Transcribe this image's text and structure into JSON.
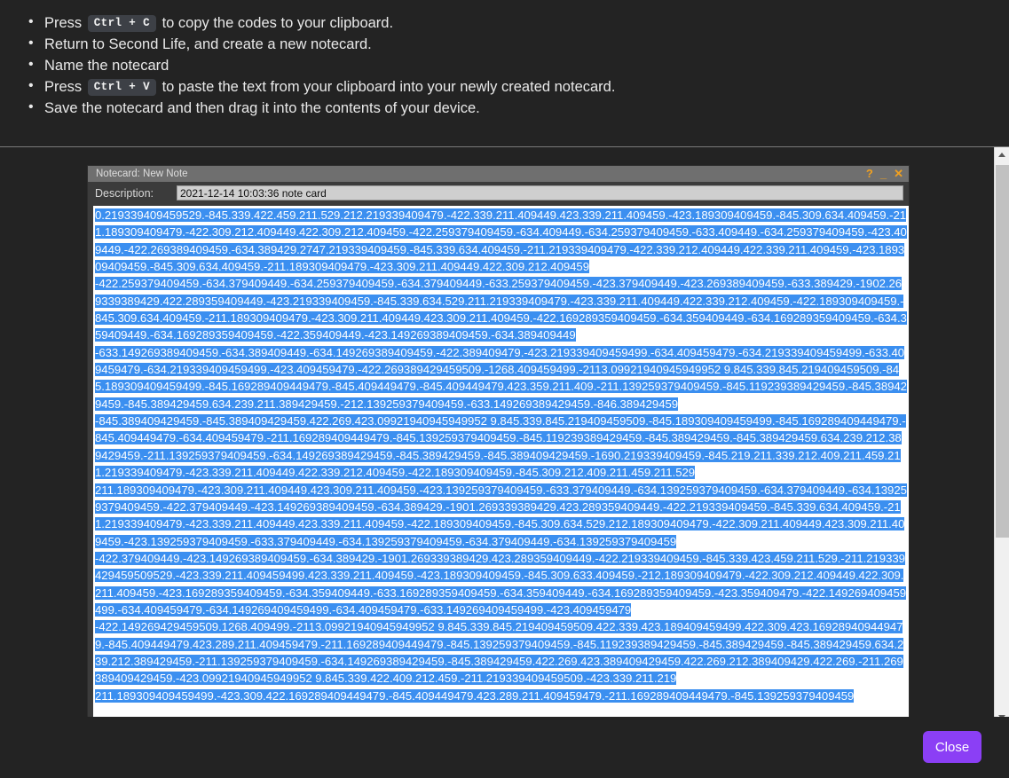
{
  "instructions": {
    "items": [
      {
        "before": "Press ",
        "kbd": "Ctrl + C",
        "after": " to copy the codes to your clipboard."
      },
      {
        "before": "Return to Second Life, and create a new notecard.",
        "kbd": "",
        "after": ""
      },
      {
        "before": "Name the notecard",
        "kbd": "",
        "after": ""
      },
      {
        "before": "Press ",
        "kbd": "Ctrl + V",
        "after": " to paste the text from your clipboard into your newly created notecard."
      },
      {
        "before": "Save the notecard and then drag it into the contents of your device.",
        "kbd": "",
        "after": ""
      }
    ]
  },
  "notecard": {
    "title": "Notecard: New Note",
    "help_label": "?",
    "minimize_label": "_",
    "close_label": "✕",
    "description_label": "Description:",
    "description_value": "2021-12-14 10:03:36 note card",
    "body_text": "0.219339409459529.-845.339.422.459.211.529.212.219339409479.-422.339.211.409449.423.339.211.409459.-423.189309409459.-845.309.634.409459.-211.189309409479.-422.309.212.409449.422.309.212.409459.-422.259379409459.-634.409449.-634.259379409459.-633.409449.-634.259379409459.-423.409449.-422.269389409459.-634.389429.2747.219339409459.-845.339.634.409459.-211.219339409479.-422.339.212.409449.422.339.211.409459.-423.189309409459.-845.309.634.409459.-211.189309409479.-423.309.211.409449.422.309.212.409459\n-422.259379409459.-634.379409449.-634.259379409459.-634.379409449.-633.259379409459.-423.379409449.-423.269389409459.-633.389429.-1902.269339389429.422.289359409449.-423.219339409459.-845.339.634.529.211.219339409479.-423.339.211.409449.422.339.212.409459.-422.189309409459.-845.309.634.409459.-211.189309409479.-423.309.211.409449.423.309.211.409459.-422.169289359409459.-634.359409449.-634.169289359409459.-634.359409449.-634.169289359409459.-422.359409449.-423.149269389409459.-634.389409449\n-633.149269389409459.-634.389409449.-634.149269389409459.-422.389409479.-423.219339409459499.-634.409459479.-634.219339409459499.-633.409459479.-634.219339409459499.-423.409459479.-422.269389429459509.-1268.409459499.-2113.09921940945949952 9.845.339.845.219409459509.-845.189309409459499.-845.169289409449479.-845.409449479.-845.409449479.423.359.211.409.-211.139259379409459.-845.119239389429459.-845.389429459.-845.389429459.634.239.211.389429459.-212.139259379409459.-633.149269389429459.-846.389429459\n-845.389409429459.-845.389409429459.422.269.423.09921940945949952 9.845.339.845.219409459509.-845.189309409459499.-845.169289409449479.-845.409449479.-634.409459479.-211.169289409449479.-845.139259379409459.-845.119239389429459.-845.389429459.-845.389429459.634.239.212.389429459.-211.139259379409459.-634.149269389429459.-845.389429459.-845.389409429459.-1690.219339409459.-845.219.211.339.212.409.211.459.211.219339409479.-423.339.211.409449.422.339.212.409459.-422.189309409459.-845.309.212.409.211.459.211.529\n211.189309409479.-423.309.211.409449.423.309.211.409459.-423.139259379409459.-633.379409449.-634.139259379409459.-634.379409449.-634.139259379409459.-422.379409449.-423.149269389409459.-634.389429.-1901.269339389429.423.289359409449.-422.219339409459.-845.339.634.409459.-211.219339409479.-423.339.211.409449.423.339.211.409459.-422.189309409459.-845.309.634.529.212.189309409479.-422.309.211.409449.423.309.211.409459.-423.139259379409459.-633.379409449.-634.139259379409459.-634.379409449.-634.139259379409459\n-422.379409449.-423.149269389409459.-634.389429.-1901.269339389429.423.289359409449.-422.219339409459.-845.339.423.459.211.529.-211.219339429459509529.-423.339.211.409459499.423.339.211.409459.-423.189309409459.-845.309.633.409459.-212.189309409479.-422.309.212.409449.422.309.211.409459.-423.169289359409459.-634.359409449.-633.169289359409459.-634.359409449.-634.169289359409459.-423.359409479.-422.149269409459499.-634.409459479.-634.149269409459499.-634.409459479.-633.149269409459499.-423.409459479\n-422.149269429459509.1268.409499.-2113.09921940945949952 9.845.339.845.219409459509.422.339.423.189409459499.422.309.423.169289409449479.-845.409449479.423.289.211.409459479.-211.169289409449479.-845.139259379409459.-845.119239389429459.-845.389429459.-845.389429459.634.239.212.389429459.-211.139259379409459.-634.149269389429459.-845.389429459.422.269.423.389409429459.422.269.212.389409429.422.269.-211.269389409429459.-423.09921940945949952 9.845.339.422.409.212.459.-211.219339409459509.-423.339.211.219\n211.189309409459499.-423.309.422.169289409449479.-845.409449479.423.289.211.409459479.-211.169289409449479.-845.139259379409459"
  },
  "scrollbar": {
    "up_label": "scroll-up",
    "down_label": "scroll-down"
  },
  "footer": {
    "close_label": "Close"
  },
  "colors": {
    "page_background": "#232323",
    "accent_purple": "#8b3ff5",
    "selection_blue": "#3b8ff0",
    "titlebar_gray": "#6f6f6f",
    "control_orange": "#f0a020"
  }
}
